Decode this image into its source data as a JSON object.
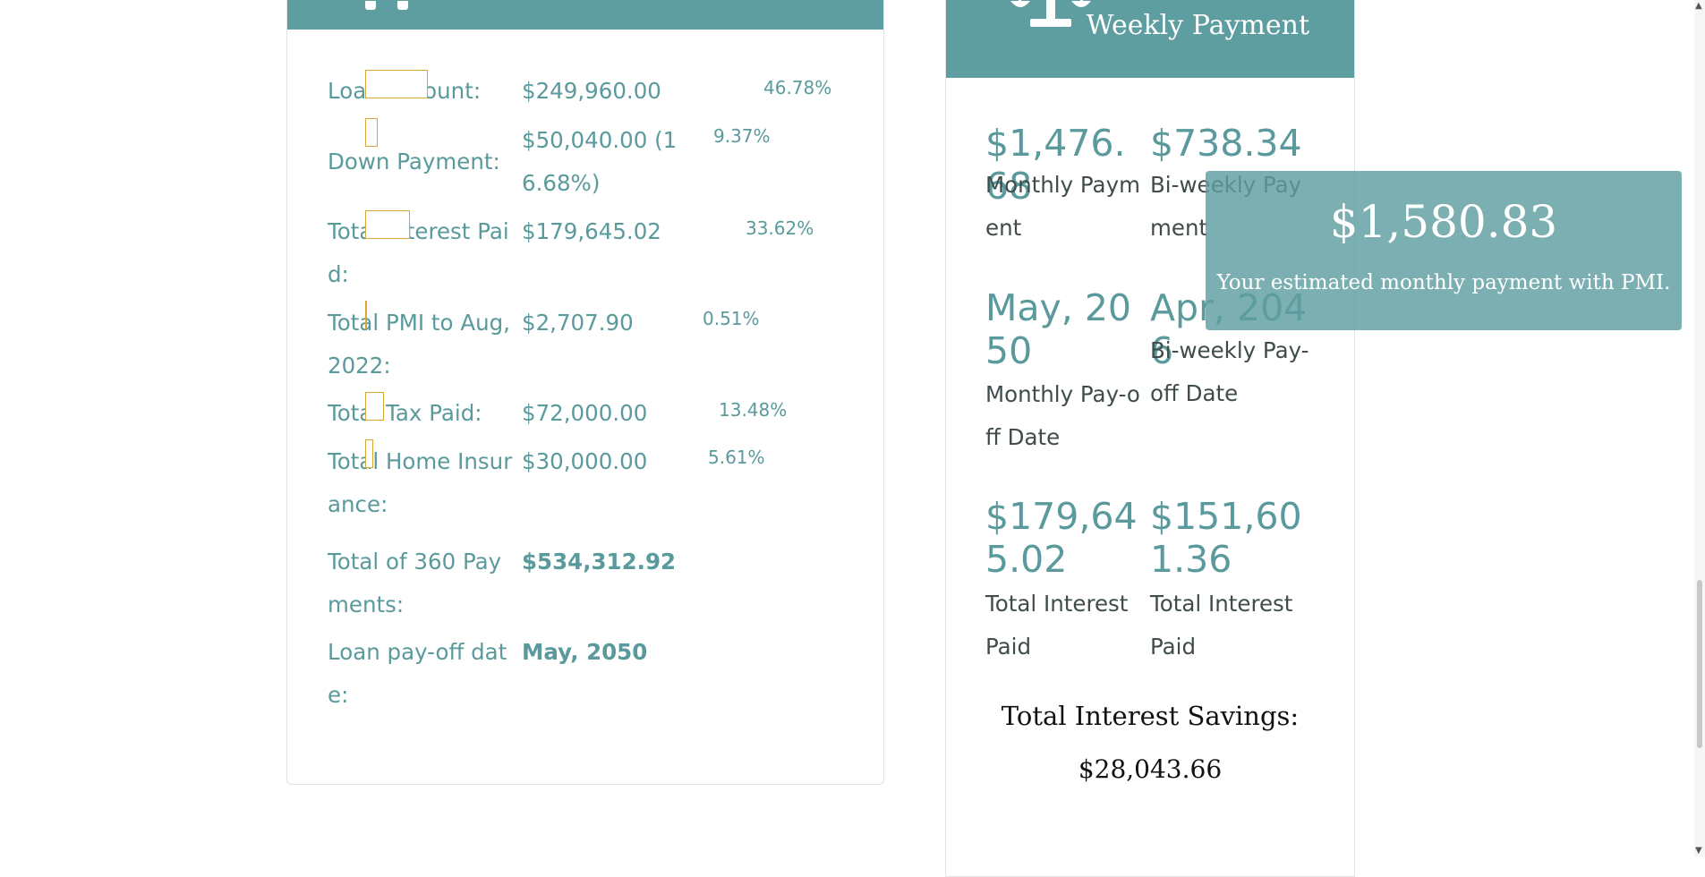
{
  "summary": {
    "rows": [
      {
        "label": "Loan Amount:",
        "value": "$249,960.00",
        "percent": 46.78,
        "percent_label": "46.78%"
      },
      {
        "label": "Down Payment:",
        "value": "$50,040.00 (16.68%)",
        "percent": 9.37,
        "percent_label": "9.37%"
      },
      {
        "label": "Total Interest Paid:",
        "value": "$179,645.02",
        "percent": 33.62,
        "percent_label": "33.62%"
      },
      {
        "label": "Total PMI to Aug, 2022:",
        "value": "$2,707.90",
        "percent": 0.51,
        "percent_label": "0.51%"
      },
      {
        "label": "Total Tax Paid:",
        "value": "$72,000.00",
        "percent": 13.48,
        "percent_label": "13.48%"
      },
      {
        "label": "Total Home Insurance:",
        "value": "$30,000.00",
        "percent": 5.61,
        "percent_label": "5.61%"
      },
      {
        "label": "Total of 360 Payments:",
        "value": "$534,312.92"
      },
      {
        "label": "Loan pay-off date:",
        "value": "May, 2050"
      }
    ]
  },
  "comparison": {
    "header_title": "Weekly Payment",
    "stats": [
      {
        "value": "$1,476.68",
        "label": "Monthly Payment"
      },
      {
        "value": "$738.34",
        "label": "Bi-weekly Payment"
      },
      {
        "value": "May, 2050",
        "label": "Monthly Pay-off Date"
      },
      {
        "value": "Apr, 2046",
        "label": "Bi-weekly Pay-off Date"
      },
      {
        "value": "$179,645.02",
        "label": "Total Interest Paid"
      },
      {
        "value": "$151,601.36",
        "label": "Total Interest Paid"
      }
    ],
    "savings_title": "Total Interest Savings:",
    "savings_value": "$28,043.66"
  },
  "tooltip": {
    "amount": "$1,580.83",
    "text": "Your estimated monthly payment with PMI."
  },
  "colors": {
    "accent": "#5f9ea0",
    "text_teal": "#5a9a9c",
    "bar_border": "#d9a534"
  },
  "icons": {
    "header_left": "tools-icon",
    "header_mid": "scale-balance-icon"
  }
}
